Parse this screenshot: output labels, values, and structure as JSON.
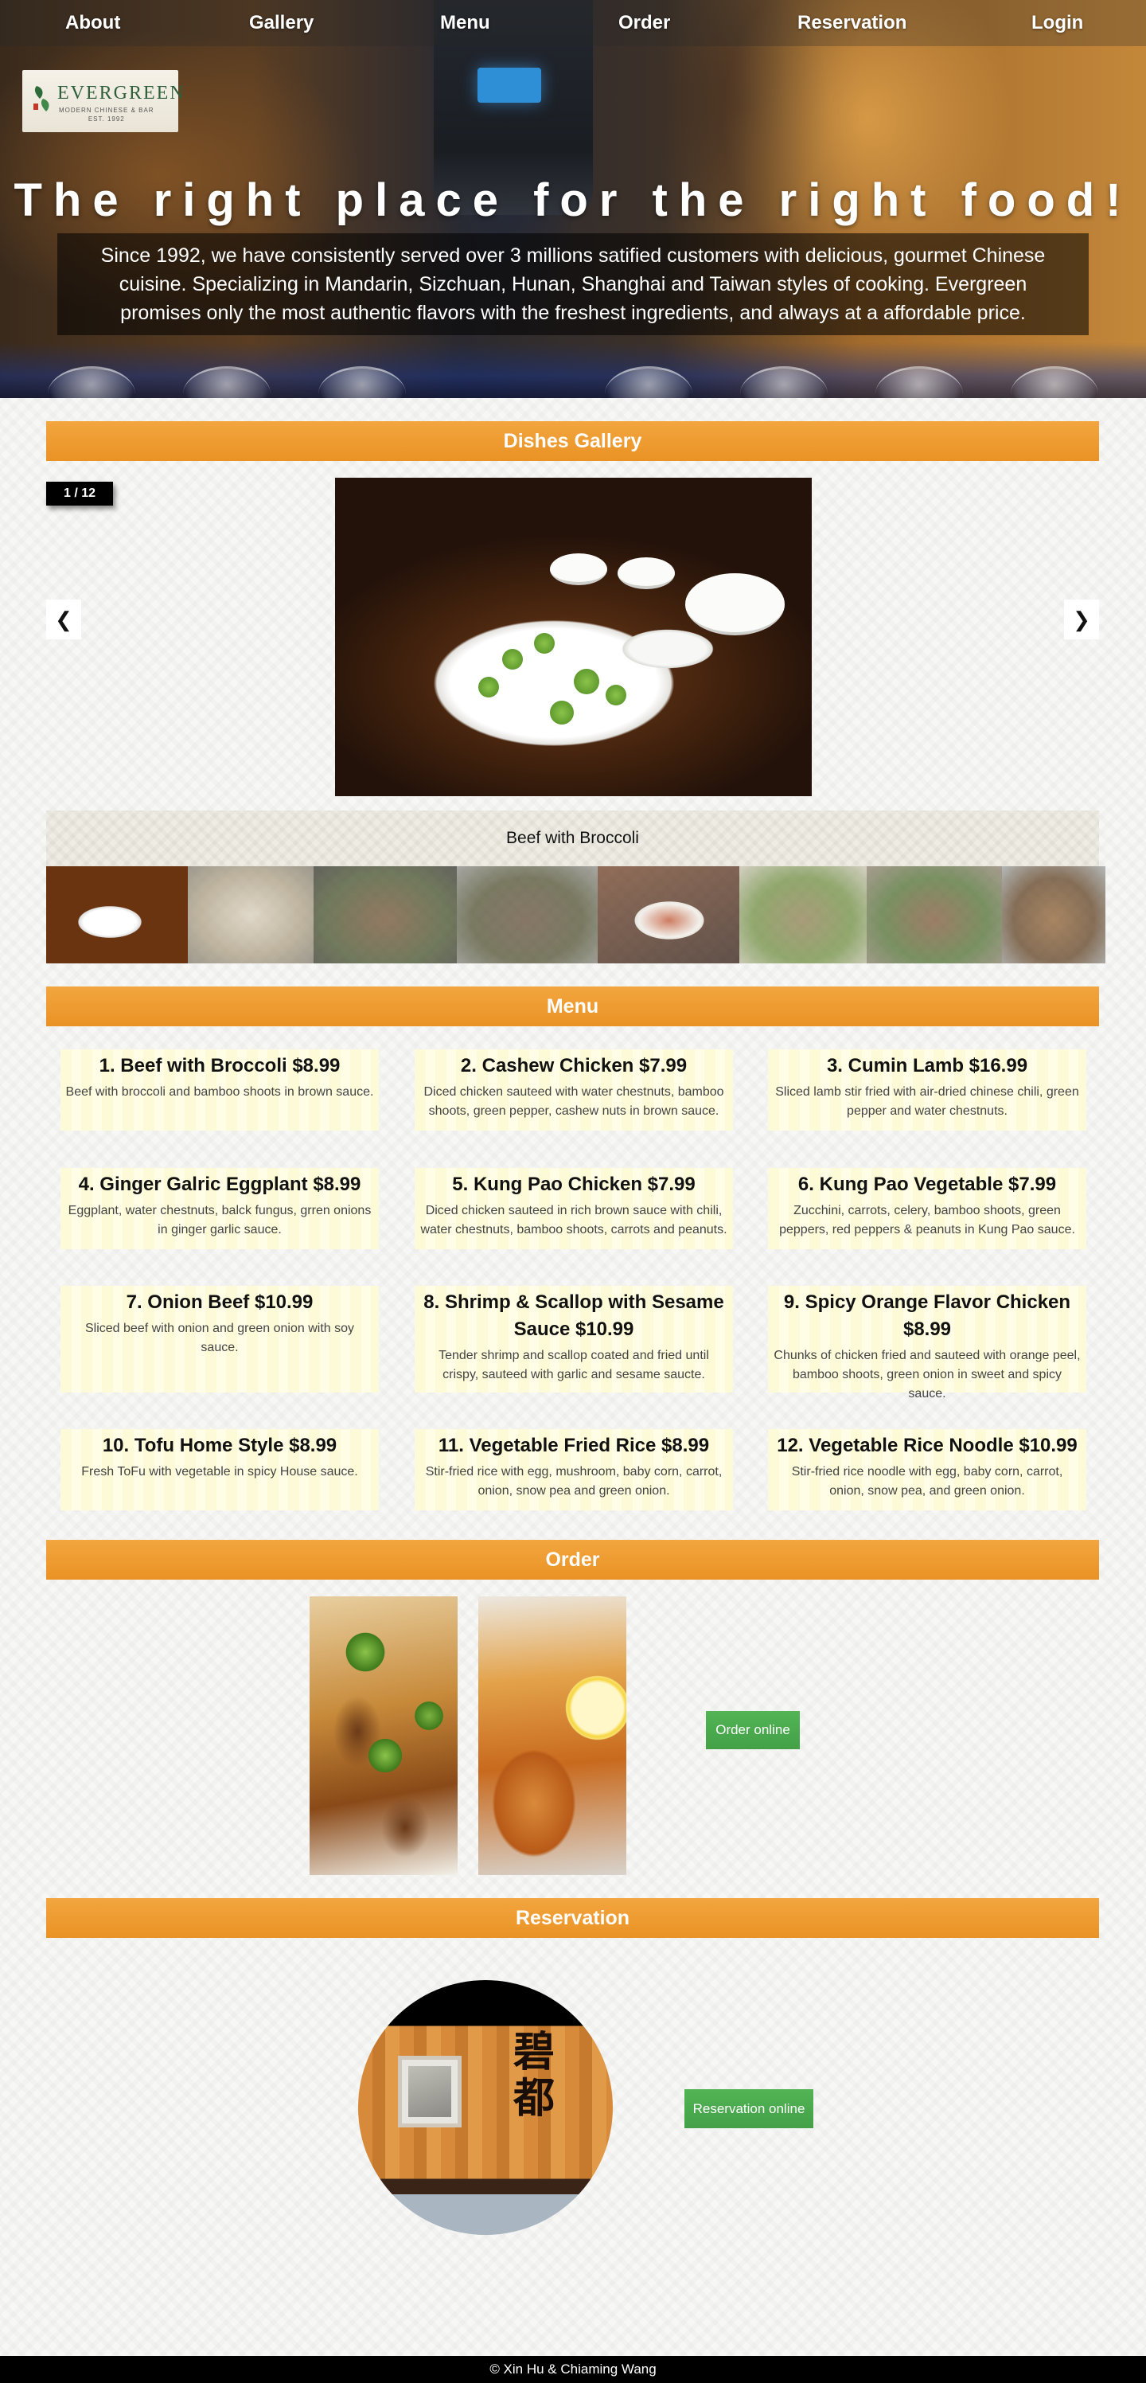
{
  "nav": {
    "about": "About",
    "gallery": "Gallery",
    "menu": "Menu",
    "order": "Order",
    "reservation": "Reservation",
    "login": "Login"
  },
  "logo": {
    "name": "EVERGREEN",
    "tagline": "MODERN CHINESE & BAR",
    "est": "EST. 1992"
  },
  "hero": {
    "title": "The right place for the right food!",
    "description": "Since 1992, we have consistently served over 3 millions satified customers with delicious, gourmet Chinese cuisine. Specializing in Mandarin, Sizchuan, Hunan, Shanghai and Taiwan styles of cooking. Evergreen promises only the most authentic flavors with the freshest ingredients, and always at a affordable price."
  },
  "gallery": {
    "title": "Dishes Gallery",
    "counter": "1 / 12",
    "prev": "❮",
    "next": "❯",
    "caption": "Beef with Broccoli"
  },
  "menu": {
    "title": "Menu",
    "items": [
      {
        "name": "1. Beef with Broccoli $8.99",
        "desc": "Beef with broccoli and bamboo shoots in brown sauce."
      },
      {
        "name": "2. Cashew Chicken $7.99",
        "desc": "Diced chicken sauteed with water chestnuts, bamboo shoots, green pepper, cashew nuts in brown sauce."
      },
      {
        "name": "3. Cumin Lamb $16.99",
        "desc": "Sliced lamb stir fried with air-dried chinese chili, green pepper and water chestnuts."
      },
      {
        "name": "4. Ginger Galric Eggplant $8.99",
        "desc": "Eggplant, water chestnuts, balck fungus, grren onions in ginger garlic sauce."
      },
      {
        "name": "5. Kung Pao Chicken $7.99",
        "desc": "Diced chicken sauteed in rich brown sauce with chili, water chestnuts, bamboo shoots, carrots and peanuts."
      },
      {
        "name": "6. Kung Pao Vegetable $7.99",
        "desc": "Zucchini, carrots, celery, bamboo shoots, green peppers, red peppers & peanuts in Kung Pao sauce."
      },
      {
        "name": "7. Onion Beef $10.99",
        "desc": "Sliced beef with onion and green onion with soy sauce."
      },
      {
        "name": "8. Shrimp & Scallop with Sesame Sauce $10.99",
        "desc": "Tender shrimp and scallop coated and fried until crispy, sauteed with garlic and sesame saucte."
      },
      {
        "name": "9. Spicy Orange Flavor Chicken $8.99",
        "desc": "Chunks of chicken fried and sauteed with orange peel, bamboo shoots, green onion in sweet and spicy sauce."
      },
      {
        "name": "10. Tofu Home Style $8.99",
        "desc": "Fresh ToFu with vegetable in spicy House sauce."
      },
      {
        "name": "11. Vegetable Fried Rice $8.99",
        "desc": "Stir-fried rice with egg, mushroom, baby corn, carrot, onion, snow pea and green onion."
      },
      {
        "name": "12. Vegetable Rice Noodle $10.99",
        "desc": "Stir-fried rice noodle with egg, baby corn, carrot, onion, snow pea, and green onion."
      }
    ]
  },
  "order": {
    "title": "Order",
    "button": "Order online"
  },
  "reservation": {
    "title": "Reservation",
    "button": "Reservation online",
    "sign": "碧都"
  },
  "footer": {
    "text": "© Xin Hu & Chiaming Wang"
  },
  "colors": {
    "accent": "#ea9224",
    "button_green": "#4caf50",
    "menu_card": "#fdfbd7"
  }
}
